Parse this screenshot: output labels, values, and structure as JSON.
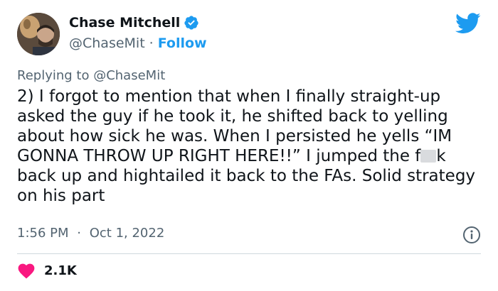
{
  "author": {
    "name": "Chase Mitchell",
    "handle": "@ChaseMit",
    "follow_label": "Follow",
    "separator": "·"
  },
  "reply": {
    "prefix": "Replying to ",
    "handle": "@ChaseMit"
  },
  "tweet": {
    "text_part1": "2) I forgot to mention that when I finally straight-up asked the guy if he took it, he shifted back to yelling about how sick he was. When I persisted he yells “IM GONNA THROW UP RIGHT HERE!!” I jumped the f",
    "text_part2": "k back up and hightailed it back to the FAs. Solid strategy on his part"
  },
  "meta": {
    "time": "1:56 PM",
    "separator": "·",
    "date": "Oct 1, 2022"
  },
  "engagement": {
    "likes": "2.1K"
  },
  "icons": {
    "brand": "twitter-bird-icon",
    "verified": "verified-badge-icon",
    "info": "info-icon",
    "like": "heart-icon"
  },
  "colors": {
    "accent": "#1d9bf0",
    "like": "#f91880",
    "text": "#0f1419",
    "muted": "#536471"
  }
}
